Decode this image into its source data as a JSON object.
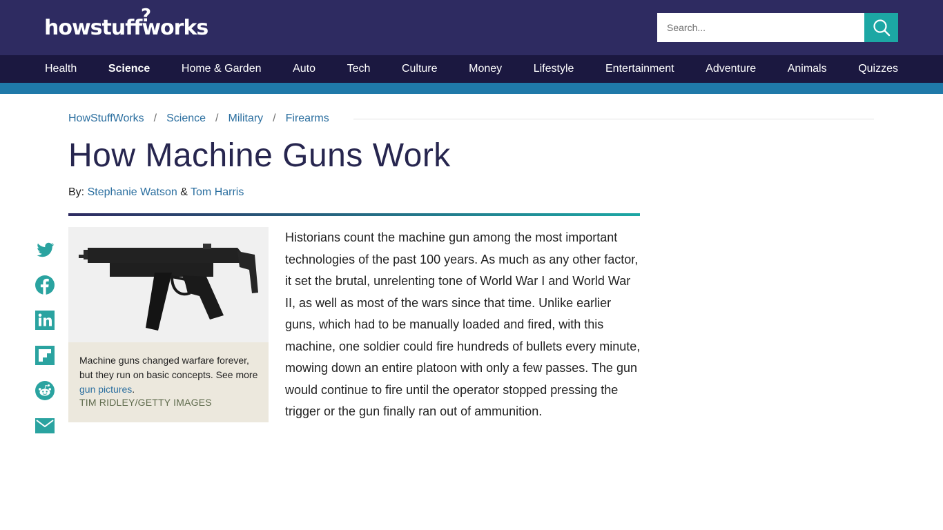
{
  "header": {
    "logo_text": "howstuffworks",
    "search_placeholder": "Search..."
  },
  "nav": {
    "items": [
      "Health",
      "Science",
      "Home & Garden",
      "Auto",
      "Tech",
      "Culture",
      "Money",
      "Lifestyle",
      "Entertainment",
      "Adventure",
      "Animals",
      "Quizzes"
    ],
    "active": "Science"
  },
  "breadcrumb": {
    "items": [
      "HowStuffWorks",
      "Science",
      "Military",
      "Firearms"
    ],
    "separator": "/"
  },
  "article": {
    "title": "How Machine Guns Work",
    "by_label": "By:",
    "author1": "Stephanie Watson",
    "amp": "&",
    "author2": "Tom Harris",
    "body": "Historians count the machine gun among the most important technologies of the past 100 years. As much as any other factor, it set the brutal, unrelenting tone of World War I and World War II, as well as most of the wars since that time. Unlike earlier guns, which had to be manually loaded and fired, with this machine, one soldier could fire hundreds of bullets every minute, mowing down an entire platoon with only a few passes. The gun would continue to fire until the operator stopped pressing the trigger or the gun finally ran out of ammunition."
  },
  "figure": {
    "caption_text": "Machine guns changed warfare forever, but they run on basic concepts. See more ",
    "caption_link": "gun pictures",
    "caption_end": ".",
    "credit": "TIM RIDLEY/GETTY IMAGES"
  },
  "social": {
    "icons": [
      "twitter-icon",
      "facebook-icon",
      "linkedin-icon",
      "flipboard-icon",
      "reddit-icon",
      "email-icon"
    ]
  },
  "colors": {
    "header_bg": "#2e2b61",
    "nav_bg": "#1b1840",
    "stripe": "#1f79a9",
    "accent": "#1ca7a4",
    "link": "#2a6e9f",
    "social": "#2aa3a0"
  }
}
